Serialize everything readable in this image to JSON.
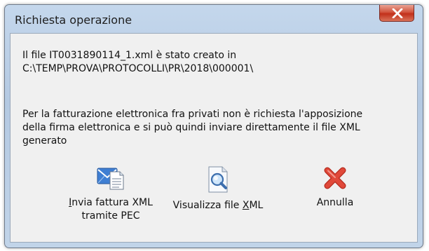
{
  "window": {
    "title": "Richiesta operazione",
    "close_glyph": "X"
  },
  "message": {
    "line1": "Il file IT0031890114_1.xml è stato creato in",
    "line2": "C:\\TEMP\\PROVA\\PROTOCOLLI\\PR\\2018\\000001\\",
    "line3": "Per la fatturazione elettronica fra privati non è richiesta l'apposizione",
    "line4": "della firma elettronica e si può quindi inviare direttamente il file XML",
    "line5": "generato"
  },
  "actions": {
    "send_pec": {
      "mnemonic": "I",
      "line1_rest": "nvia fattura XML",
      "line2": "tramite PEC",
      "icon": "email-document-icon"
    },
    "view_xml": {
      "before": "Visualizza file ",
      "mnemonic": "X",
      "after": "ML",
      "icon": "magnifier-document-icon"
    },
    "cancel": {
      "label": "Annulla",
      "icon": "red-x-icon"
    }
  },
  "colors": {
    "frame": "#b9cde5",
    "client": "#f0f0f0",
    "close_button": "#c9442e",
    "cancel_icon": "#d63b2b"
  }
}
